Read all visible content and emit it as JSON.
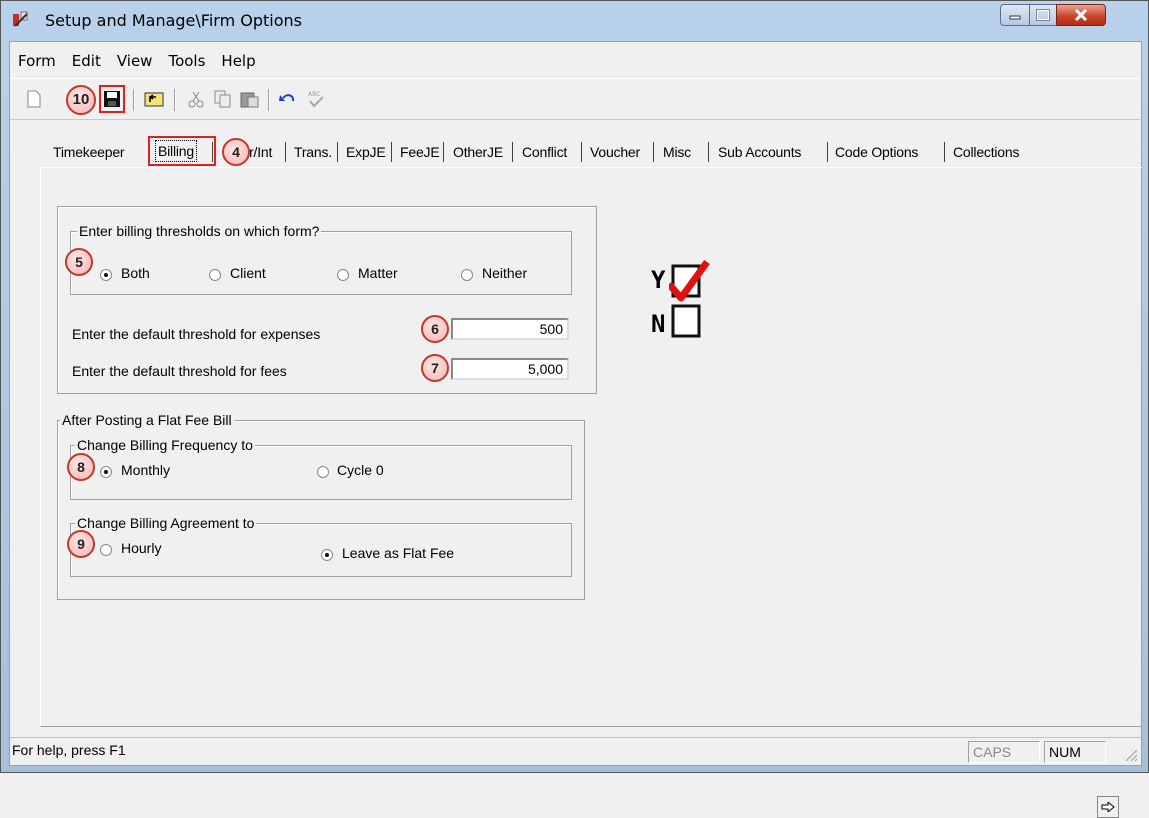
{
  "window": {
    "title": "Setup and Manage\\Firm Options"
  },
  "menu": [
    "Form",
    "Edit",
    "View",
    "Tools",
    "Help"
  ],
  "toolbar": {
    "callout_save": "10",
    "icons": [
      "new-document-icon",
      "save-icon",
      "open-folder-icon",
      "cut-icon",
      "copy-icon",
      "paste-icon",
      "undo-icon",
      "spellcheck-icon"
    ]
  },
  "tabs": [
    "Timekeeper",
    "Billing",
    "Hour/Int",
    "Trans.",
    "ExpJE",
    "FeeJE",
    "OtherJE",
    "Conflict",
    "Voucher",
    "Misc",
    "Sub Accounts",
    "Code Options",
    "Collections"
  ],
  "tab_callout": "4",
  "thresholds_group": {
    "legend": "Enter billing thresholds on which form?",
    "callout": "5",
    "options": [
      {
        "label": "Both",
        "selected": true
      },
      {
        "label": "Client",
        "selected": false
      },
      {
        "label": "Matter",
        "selected": false
      },
      {
        "label": "Neither",
        "selected": false
      }
    ],
    "expenses_label": "Enter the default threshold for expenses",
    "expenses_value": "500",
    "expenses_callout": "6",
    "fees_label": "Enter the default threshold for fees",
    "fees_value": "5,000",
    "fees_callout": "7"
  },
  "flat_fee_group": {
    "legend": "After Posting a Flat Fee Bill",
    "frequency": {
      "legend": "Change Billing Frequency to",
      "callout": "8",
      "options": [
        {
          "label": "Monthly",
          "selected": true
        },
        {
          "label": "Cycle 0",
          "selected": false
        }
      ]
    },
    "agreement": {
      "legend": "Change Billing Agreement to",
      "callout": "9",
      "options": [
        {
          "label": "Hourly",
          "selected": false
        },
        {
          "label": "Leave as Flat Fee",
          "selected": true
        }
      ]
    }
  },
  "yn_graphic": {
    "yes": "Y",
    "no": "N"
  },
  "status": {
    "help": "For help, press F1",
    "caps": "CAPS",
    "num": "NUM"
  }
}
